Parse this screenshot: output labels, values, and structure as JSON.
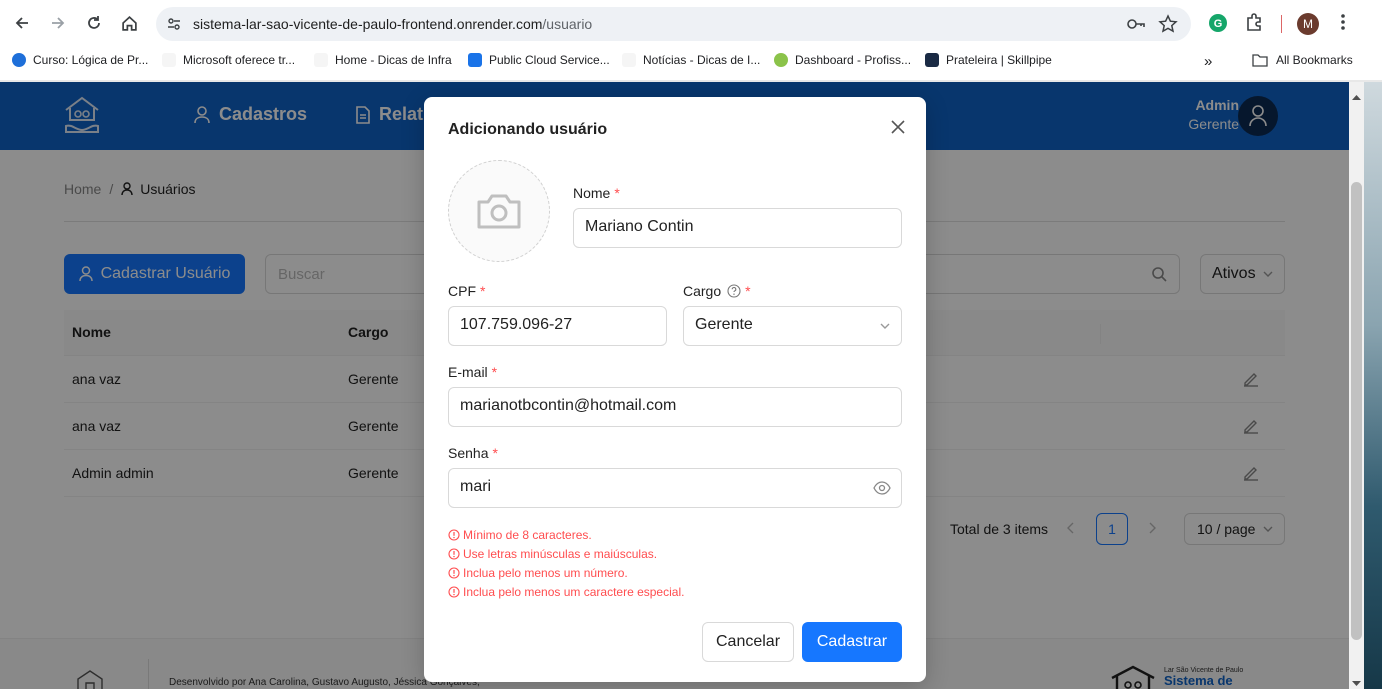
{
  "browser": {
    "url_host": "sistema-lar-sao-vicente-de-paulo-frontend.onrender.com",
    "url_path": "/usuario",
    "profile_initial": "M",
    "bookmarks": [
      {
        "label": "Curso: Lógica de Pr...",
        "color": "#1e6fd9"
      },
      {
        "label": "Microsoft oferece tr...",
        "color": "#ffffff"
      },
      {
        "label": "Home - Dicas de Infra",
        "color": "#ffffff"
      },
      {
        "label": "Public Cloud Service...",
        "color": "#1a73e8"
      },
      {
        "label": "Notícias - Dicas de I...",
        "color": "#ffffff"
      },
      {
        "label": "Dashboard - Profiss...",
        "color": "#8bc34a"
      },
      {
        "label": "Prateleira | Skillpipe",
        "color": "#1a2a44"
      }
    ],
    "overflow": "»",
    "all_bookmarks": "All Bookmarks"
  },
  "app": {
    "nav": [
      {
        "label": "Cadastros",
        "icon": "user-icon"
      },
      {
        "label": "Relat",
        "icon": "document-icon"
      }
    ],
    "user": {
      "name": "Admin",
      "role": "Gerente"
    },
    "breadcrumb": {
      "home": "Home",
      "sep": "/",
      "current": "Usuários"
    },
    "create_button": "Cadastrar Usuário",
    "search_placeholder": "Buscar",
    "status_filter": "Ativos",
    "table": {
      "columns": [
        "Nome",
        "Cargo"
      ],
      "rows": [
        {
          "nome": "ana vaz",
          "cargo": "Gerente"
        },
        {
          "nome": "ana vaz",
          "cargo": "Gerente"
        },
        {
          "nome": "Admin admin",
          "cargo": "Gerente"
        }
      ]
    },
    "pagination": {
      "total": "Total de 3 items",
      "page": "1",
      "page_size": "10 / page"
    },
    "footer": {
      "credits": "Desenvolvido por Ana Carolina, Gustavo Augusto, Jéssica Gonçalves,",
      "brand_small": "Lar São Vicente de Paulo",
      "brand_big": "Sistema de"
    }
  },
  "modal": {
    "title": "Adicionando usuário",
    "nome_label": "Nome",
    "nome_value": "Mariano Contin",
    "cpf_label": "CPF",
    "cpf_value": "107.759.096-27",
    "cargo_label": "Cargo",
    "cargo_value": "Gerente",
    "email_label": "E-mail",
    "email_value": "marianotbcontin@hotmail.com",
    "senha_label": "Senha",
    "senha_value": "mari",
    "required_mark": "*",
    "errors": [
      "Mínimo de 8 caracteres.",
      "Use letras minúsculas e maiúsculas.",
      "Inclua pelo menos um número.",
      "Inclua pelo menos um caractere especial."
    ],
    "cancel_label": "Cancelar",
    "submit_label": "Cadastrar"
  },
  "colors": {
    "primary": "#1677ff",
    "appbar": "#1063c7",
    "error": "#ff4d4f"
  }
}
